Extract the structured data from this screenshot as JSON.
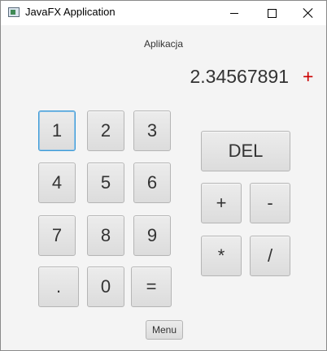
{
  "window": {
    "title": "JavaFX Application",
    "controls": {
      "minimize": "minimize",
      "maximize": "maximize",
      "close": "close"
    }
  },
  "app": {
    "heading": "Aplikacja",
    "display_value": "2.34567891",
    "operator_indicator": "+",
    "operator_color": "#cc0000"
  },
  "keypad": {
    "digits": [
      "1",
      "2",
      "3",
      "4",
      "5",
      "6",
      "7",
      "8",
      "9",
      ".",
      "0",
      "="
    ],
    "ops": {
      "del": "DEL",
      "plus": "+",
      "minus": "-",
      "multiply": "*",
      "divide": "/"
    }
  },
  "menu": {
    "label": "Menu"
  }
}
